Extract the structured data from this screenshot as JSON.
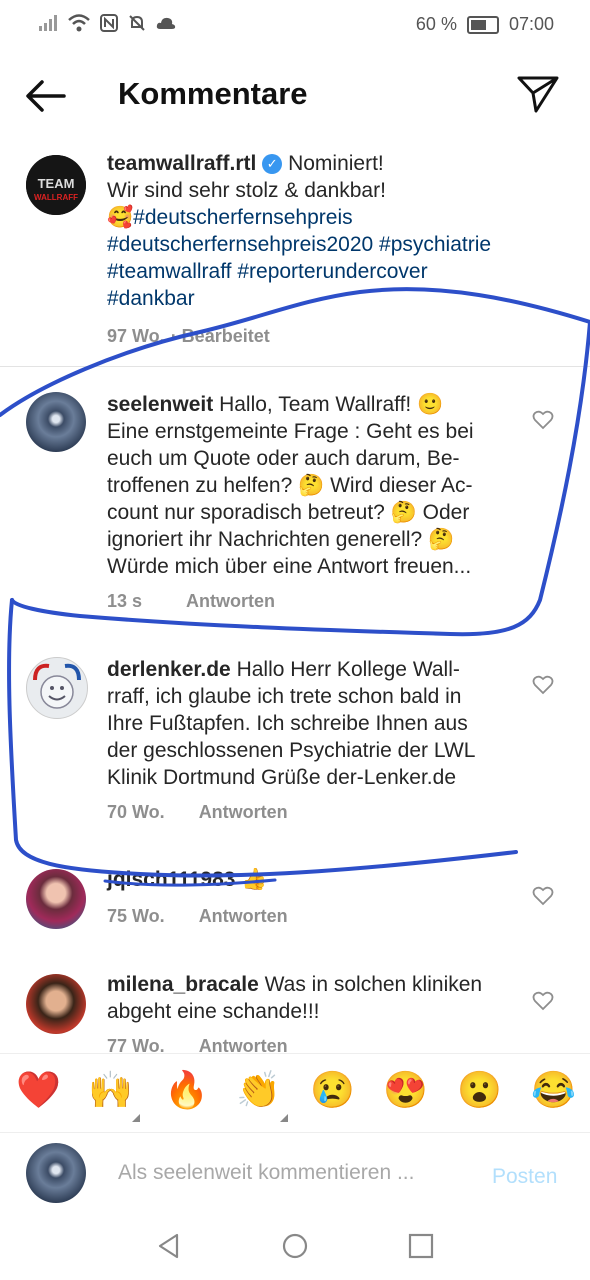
{
  "status_bar": {
    "battery": "60 %",
    "time": "07:00"
  },
  "header": {
    "title": "Kommentare"
  },
  "caption": {
    "username": "teamwallraff.rtl",
    "text1": "Nominiert!",
    "text2": "Wir sind sehr stolz & dankbar!",
    "emoji": "🥰",
    "hashtags_line1": "#deutscherfernsehpreis",
    "hashtags_line2": "#deutscherfernsehpreis2020 #psychiatrie",
    "hashtags_line3": "#teamwallraff #reporterundercover",
    "hashtags_line4": "#dankbar",
    "time": "97 Wo.",
    "edited": "· Bearbeitet",
    "avatar_text1": "TEAM",
    "avatar_text2": "WALLRAFF"
  },
  "comments": [
    {
      "username": "seelenweit",
      "lines": [
        "Hallo, Team Wallraff! 🙂",
        "Eine ernstgemeinte Frage : Geht es bei",
        "euch um Quote oder auch darum, Be-",
        "troffenen zu helfen? 🤔 Wird dieser Ac-",
        "count nur sporadisch betreut? 🤔 Oder",
        "ignoriert ihr Nachrichten generell? 🤔",
        "Würde mich über eine Antwort freuen..."
      ],
      "time": "13 s",
      "reply": "Antworten"
    },
    {
      "username": "derlenker.de",
      "lines": [
        "Hallo Herr Kollege Wall-",
        "rraff, ich glaube ich trete schon bald in",
        "Ihre Fußtapfen. Ich schreibe Ihnen aus",
        "der geschlossenen Psychiatrie der LWL",
        "Klinik Dortmund Grüße  der-Lenker.de"
      ],
      "time": "70 Wo.",
      "reply": "Antworten"
    },
    {
      "username": "jqlsch111983",
      "lines": [
        "👍"
      ],
      "time": "75 Wo.",
      "reply": "Antworten"
    },
    {
      "username": "milena_bracale",
      "lines": [
        "Was in solchen kliniken",
        "abgeht eine schande!!!"
      ],
      "time": "77 Wo.",
      "reply": "Antworten"
    }
  ],
  "emoji_bar": [
    "❤️",
    "🙌",
    "🔥",
    "👏",
    "😢",
    "😍",
    "😮",
    "😂"
  ],
  "input": {
    "placeholder": "Als seelenweit kommentieren ...",
    "post": "Posten"
  },
  "colors": {
    "ink": "#2d4fc9",
    "link": "#00376b",
    "post_disabled": "#b2dffc"
  }
}
